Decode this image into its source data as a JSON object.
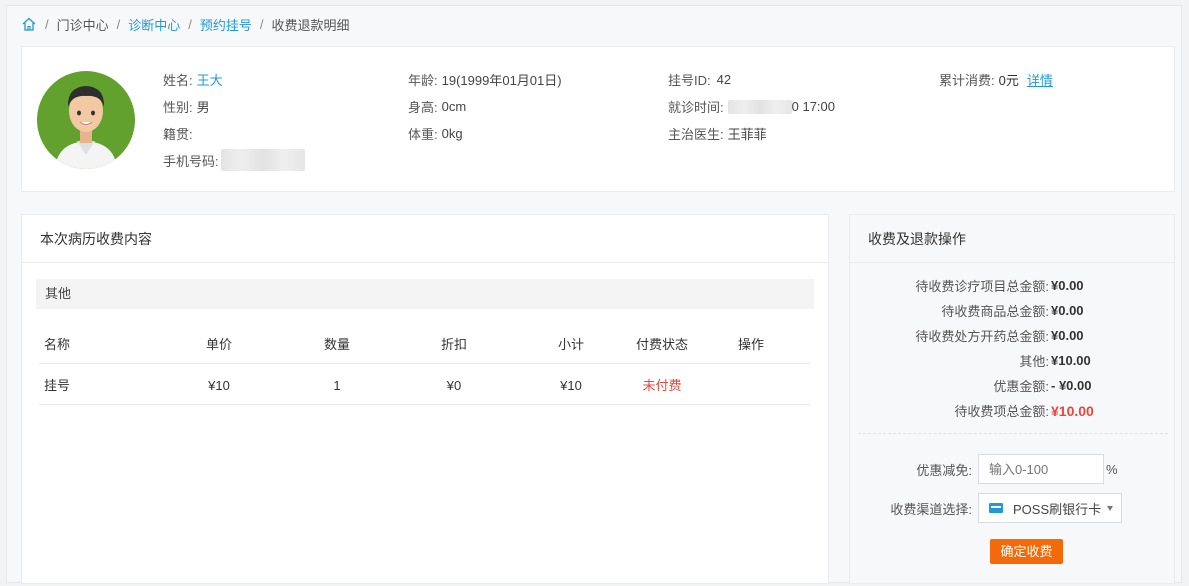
{
  "breadcrumb": {
    "items": [
      {
        "label": "门诊中心",
        "link": false
      },
      {
        "label": "诊断中心",
        "link": true
      },
      {
        "label": "预约挂号",
        "link": true
      },
      {
        "label": "收费退款明细",
        "link": false
      }
    ],
    "separator": "/"
  },
  "patient": {
    "name_label": "姓名:",
    "name": "王大",
    "gender_label": "性别:",
    "gender": "男",
    "native_label": "籍贯:",
    "native": "",
    "phone_label": "手机号码:",
    "age_label": "年龄:",
    "age": "19(1999年01月01日)",
    "height_label": "身高:",
    "height": "0cm",
    "weight_label": "体重:",
    "weight": "0kg",
    "reg_id_label": "挂号ID:",
    "reg_id": "42",
    "visit_time_label": "就诊时间:",
    "visit_time_tail": "0 17:00",
    "doctor_label": "主治医生:",
    "doctor": "王菲菲",
    "total_spent_label": "累计消费:",
    "total_spent": "0元",
    "detail_link": "详情"
  },
  "fees": {
    "title": "本次病历收费内容",
    "group": "其他",
    "columns": [
      "名称",
      "单价",
      "数量",
      "折扣",
      "小计",
      "付费状态",
      "操作"
    ],
    "rows": [
      {
        "name": "挂号",
        "price": "¥10",
        "qty": "1",
        "discount": "¥0",
        "subtotal": "¥10",
        "status": "未付费",
        "op": ""
      }
    ]
  },
  "ops": {
    "title": "收费及退款操作",
    "summary": [
      {
        "label": "待收费诊疗项目总金额:",
        "value": "¥0.00"
      },
      {
        "label": "待收费商品总金额:",
        "value": "¥0.00"
      },
      {
        "label": "待收费处方开药总金额:",
        "value": "¥0.00"
      },
      {
        "label": "其他:",
        "value": "¥10.00"
      },
      {
        "label": "优惠金额:",
        "value": "- ¥0.00"
      },
      {
        "label": "待收费项总金额:",
        "value": "¥10.00"
      }
    ],
    "discount_label": "优惠减免:",
    "discount_placeholder": "输入0-100",
    "discount_unit": "%",
    "channel_label": "收费渠道选择:",
    "channel_value": "POSS刷银行卡",
    "confirm_label": "确定收费"
  },
  "colors": {
    "link": "#1f9ad6",
    "danger": "#e8483b",
    "confirm": "#f26a0a",
    "avatar_bg": "#62a12d"
  }
}
